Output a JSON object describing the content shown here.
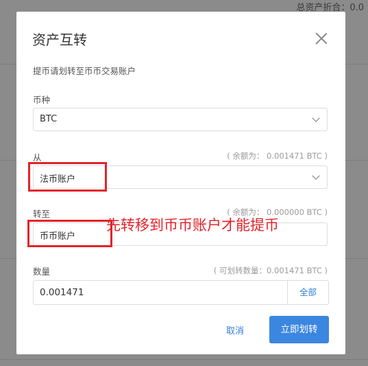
{
  "background": {
    "header_fragment": "总资产折合：0.0"
  },
  "dialog": {
    "title": "资产互转",
    "hint": "提币请划转至币币交易账户",
    "currency": {
      "label": "币种",
      "value": "BTC"
    },
    "from": {
      "label": "从",
      "balance": "( 余额为： 0.001471 BTC )",
      "value": "法币账户"
    },
    "to": {
      "label": "转至",
      "balance": "( 余额为： 0.000000 BTC )",
      "value": "币币账户"
    },
    "quantity": {
      "label": "数量",
      "available": "( 可划转数量：0.001471 BTC )",
      "value": "0.001471",
      "all_label": "全部"
    },
    "cancel_label": "取消",
    "confirm_label": "立即划转"
  },
  "annotation": {
    "note": "先转移到币币账户才能提币",
    "color": "#e3232a"
  },
  "colors": {
    "accent": "#3b86e0",
    "link": "#2f7fd8",
    "overlay": "#8b8b8b"
  }
}
